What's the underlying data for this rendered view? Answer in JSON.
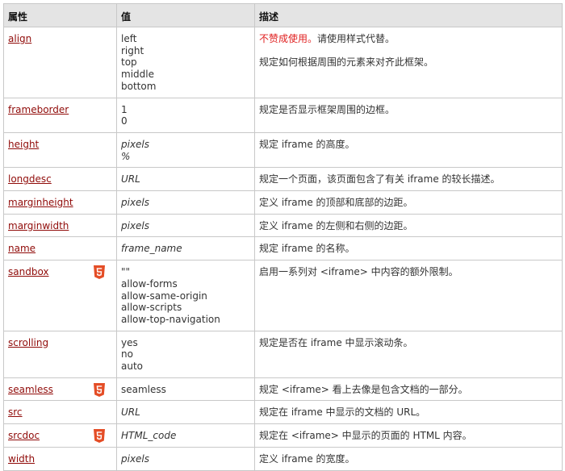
{
  "headers": [
    "属性",
    "值",
    "描述"
  ],
  "colors": {
    "link": "#900b09",
    "deprecated": "#e02020",
    "html5_badge": "#e44d26"
  },
  "rows": [
    {
      "name": "align",
      "html5": false,
      "italic": false,
      "values": [
        "left",
        "right",
        "top",
        "middle",
        "bottom"
      ],
      "desc": {
        "warning": "不赞成使用。",
        "main": "请使用样式代替。",
        "extra": "规定如何根据周围的元素来对齐此框架。"
      }
    },
    {
      "name": "frameborder",
      "html5": false,
      "italic": false,
      "values": [
        "1",
        "0"
      ],
      "desc": {
        "main": "规定是否显示框架周围的边框。"
      }
    },
    {
      "name": "height",
      "html5": false,
      "italic": true,
      "values": [
        "pixels",
        "%"
      ],
      "desc": {
        "main": "规定 iframe 的高度。"
      }
    },
    {
      "name": "longdesc",
      "html5": false,
      "italic": true,
      "values": [
        "URL"
      ],
      "desc": {
        "main": "规定一个页面，该页面包含了有关 iframe 的较长描述。"
      }
    },
    {
      "name": "marginheight",
      "html5": false,
      "italic": true,
      "values": [
        "pixels"
      ],
      "desc": {
        "main": "定义 iframe 的顶部和底部的边距。"
      }
    },
    {
      "name": "marginwidth",
      "html5": false,
      "italic": true,
      "values": [
        "pixels"
      ],
      "desc": {
        "main": "定义 iframe 的左侧和右侧的边距。"
      }
    },
    {
      "name": "name",
      "html5": false,
      "italic": true,
      "values": [
        "frame_name"
      ],
      "desc": {
        "main": "规定 iframe 的名称。"
      }
    },
    {
      "name": "sandbox",
      "html5": true,
      "italic": false,
      "values": [
        "\"\"",
        "allow-forms",
        "allow-same-origin",
        "allow-scripts",
        "allow-top-navigation"
      ],
      "desc": {
        "main": "启用一系列对 <iframe> 中内容的额外限制。"
      }
    },
    {
      "name": "scrolling",
      "html5": false,
      "italic": false,
      "values": [
        "yes",
        "no",
        "auto"
      ],
      "desc": {
        "main": "规定是否在 iframe 中显示滚动条。"
      }
    },
    {
      "name": "seamless",
      "html5": true,
      "italic": false,
      "values": [
        "seamless"
      ],
      "desc": {
        "main": "规定 <iframe> 看上去像是包含文档的一部分。"
      }
    },
    {
      "name": "src",
      "html5": false,
      "italic": true,
      "values": [
        "URL"
      ],
      "desc": {
        "main": "规定在 iframe 中显示的文档的 URL。"
      }
    },
    {
      "name": "srcdoc",
      "html5": true,
      "italic": true,
      "values": [
        "HTML_code"
      ],
      "desc": {
        "main": "规定在 <iframe> 中显示的页面的 HTML 内容。"
      }
    },
    {
      "name": "width",
      "html5": false,
      "italic": true,
      "values": [
        "pixels"
      ],
      "desc": {
        "main": "定义 iframe 的宽度。"
      }
    }
  ]
}
